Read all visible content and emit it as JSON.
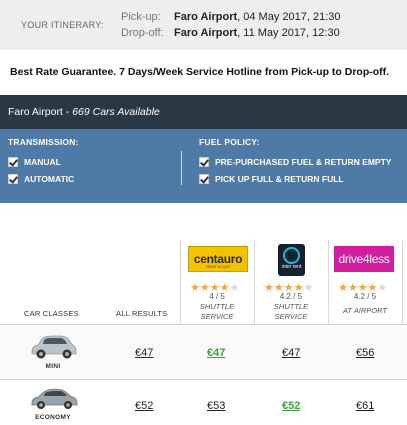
{
  "itinerary": {
    "label": "YOUR ITINERARY:",
    "pickup_key": "Pick-up:",
    "pickup_location": "Faro Airport",
    "pickup_date": ", 04 May 2017, 21:30",
    "dropoff_key": "Drop-off:",
    "dropoff_location": "Faro Airport",
    "dropoff_date": ", 11 May 2017, 12:30"
  },
  "guarantee": "Best Rate Guarantee. 7 Days/Week Service Hotline from Pick-up to Drop-off.",
  "location_bar": {
    "location": "Faro Airport",
    "separator": " - ",
    "count": "669 Cars Available"
  },
  "filters": {
    "transmission": {
      "title": "TRANSMISSION:",
      "options": [
        "MANUAL",
        "AUTOMATIC"
      ]
    },
    "fuel": {
      "title": "FUEL POLICY:",
      "options": [
        "PRE-PURCHASED FUEL & RETURN EMPTY",
        "PICK UP FULL & RETURN FULL"
      ]
    }
  },
  "table": {
    "col_car_classes": "CAR CLASSES",
    "col_all_results": "ALL RESULTS",
    "suppliers": [
      {
        "name": "centauro",
        "logo_sub": "RENT A CAR",
        "rating_stars": 4,
        "rating": "4 / 5",
        "service": "SHUTTLE SERVICE",
        "service_line1": "SHUTTLE",
        "service_line2": "SERVICE",
        "icon": "centauro-logo"
      },
      {
        "name": "interrent",
        "logo_text": "inter rent",
        "rating_stars": 4,
        "rating": "4.2 / 5",
        "service": "SHUTTLE SERVICE",
        "service_line1": "SHUTTLE",
        "service_line2": "SERVICE",
        "icon": "interrent-logo"
      },
      {
        "name": "drive4less",
        "rating_stars": 4,
        "rating": "4.2 / 5",
        "service": "AT AIRPORT",
        "service_line1": "AT AIRPORT",
        "service_line2": "",
        "icon": "drive4less-logo"
      }
    ],
    "rows": [
      {
        "class": "MINI",
        "all": "€47",
        "prices": [
          "€47",
          "€47",
          "€56"
        ],
        "best_index": 0,
        "car_color": "#b9c4cc"
      },
      {
        "class": "ECONOMY",
        "all": "€52",
        "prices": [
          "€53",
          "€52",
          "€61"
        ],
        "best_index": 1,
        "car_color": "#9aa3aa"
      }
    ]
  },
  "colors": {
    "accent_dark": "#2a3744",
    "filter_blue": "#4f79a6",
    "best_price_green": "#3aa53a",
    "star": "#f2a541"
  }
}
